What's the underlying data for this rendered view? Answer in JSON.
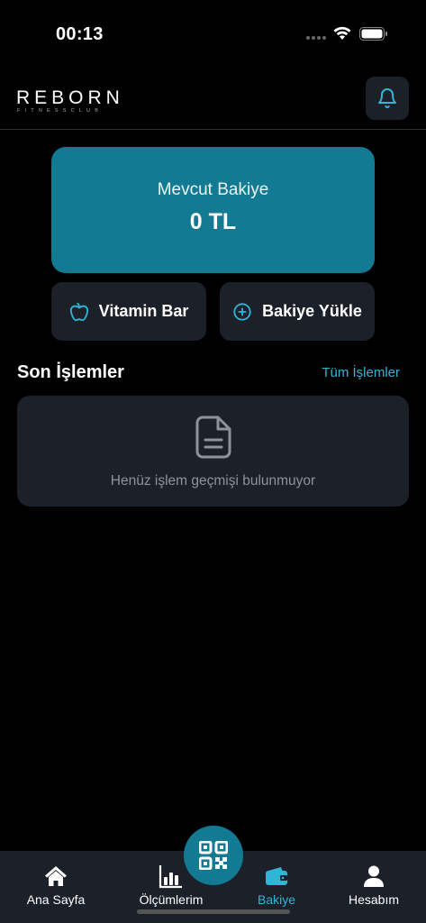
{
  "status_bar": {
    "time": "00:13"
  },
  "header": {
    "logo_text": "REBORN",
    "logo_subtext": "FITNESSCLUB"
  },
  "balance": {
    "label": "Mevcut Bakiye",
    "value": "0 TL"
  },
  "actions": {
    "vitamin_bar": "Vitamin Bar",
    "load_balance": "Bakiye Yükle"
  },
  "transactions": {
    "title": "Son İşlemler",
    "see_all": "Tüm İşlemler",
    "empty_message": "Henüz işlem geçmişi bulunmuyor"
  },
  "bottom_nav": {
    "items": [
      {
        "label": "Ana Sayfa",
        "icon": "home-icon",
        "active": false
      },
      {
        "label": "Ölçümlerim",
        "icon": "bar-chart-icon",
        "active": false
      },
      {
        "label": "Bakiye",
        "icon": "wallet-icon",
        "active": true
      },
      {
        "label": "Hesabım",
        "icon": "person-icon",
        "active": false
      }
    ]
  },
  "colors": {
    "accent": "#137a93",
    "accent_text": "#2fb6d6",
    "card": "#1b2029",
    "background": "#000000"
  }
}
